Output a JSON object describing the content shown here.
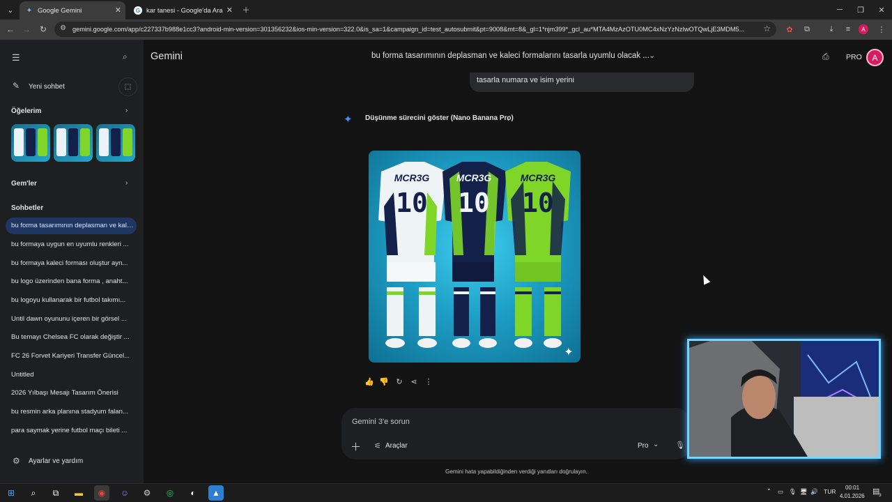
{
  "browser": {
    "tabs": [
      {
        "title": "Google Gemini",
        "icon": "gemini-icon"
      },
      {
        "title": "kar tanesi - Google'da Ara",
        "icon": "google-icon"
      }
    ],
    "url": "gemini.google.com/app/c227337b988e1cc3?android-min-version=301356232&ios-min-version=322.0&is_sa=1&campaign_id=test_autosubmit&pt=9008&mt=8&_gl=1*njm399*_gcl_au*MTA4MzAzOTU0MC4xNzYzNzIwOTQwLjE3MDM5..."
  },
  "sidebar": {
    "new_chat": "Yeni sohbet",
    "my_stuff": "Öğelerim",
    "gems": "Gem'ler",
    "chats_heading": "Sohbetler",
    "chats": [
      "bu forma tasarımının deplasman ve kaleci formalarını tasarla uyumlu olacak",
      "bu formaya uygun en uyumlu renkleri ...",
      "bu formaya kaleci forması oluştur ayn...",
      "bu logo üzerinden bana forma , anaht...",
      "bu logoyu kullanarak bir futbol takımı...",
      "Until dawn oyununu içeren bir görsel ...",
      "Bu temayı Chelsea FC olarak değiştir ...",
      "FC 26 Forvet Kariyeri Transfer Güncel...",
      "Untitled",
      "2026 Yılbaşı Mesajı Tasarım Önerisi",
      "bu resmin arka planına stadyum falan...",
      "para saymak yerine futbol maçı bileti ..."
    ],
    "settings": "Ayarlar ve yardım"
  },
  "header": {
    "app_title": "Gemini",
    "conversation_title": "bu forma tasarımının deplasman ve kaleci formalarını tasarla uyumlu olacak ...",
    "plan_badge": "PRO",
    "avatar_letter": "A"
  },
  "conversation": {
    "user_message_tail": "tasarla numara ve isim yerini",
    "thinking_label": "Düşünme sürecini göster (Nano Banana Pro)",
    "kit_text": "MCR3G",
    "kit_number": "10",
    "kit_colors": [
      "#e9f1f4",
      "#13204a",
      "#7fd628"
    ]
  },
  "composer": {
    "placeholder": "Gemini 3'e sorun",
    "tools_label": "Araçlar",
    "mode_label": "Pro",
    "disclaimer": "Gemini hata yapabildiğinden verdiği yanıtları doğrulayın."
  },
  "taskbar": {
    "language": "TUR",
    "time": "00:01",
    "date": "4.01.2026",
    "notification_count": "3"
  }
}
